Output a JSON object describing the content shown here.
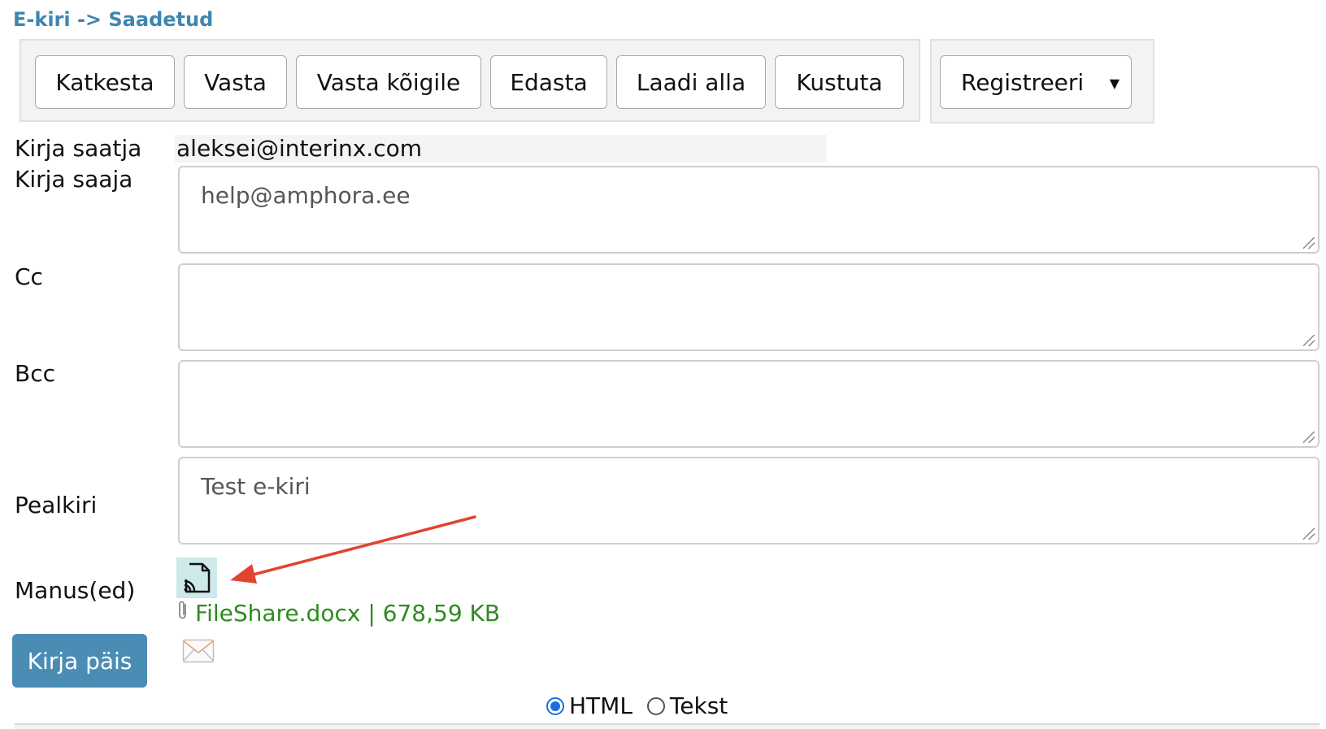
{
  "breadcrumb": "E-kiri -> Saadetud",
  "toolbar": {
    "cancel_label": "Katkesta",
    "reply_label": "Vasta",
    "reply_all_label": "Vasta kõigile",
    "forward_label": "Edasta",
    "download_label": "Laadi alla",
    "delete_label": "Kustuta",
    "register_label": "Registreeri"
  },
  "form": {
    "sender_label": "Kirja saatja",
    "sender_value": "aleksei@interinx.com",
    "recipient_label": "Kirja saaja",
    "recipient_value": "help@amphora.ee",
    "cc_label": "Cc",
    "cc_value": "",
    "bcc_label": "Bcc",
    "bcc_value": "",
    "subject_label": "Pealkiri",
    "subject_value": "Test e-kiri",
    "attachments_label": "Manus(ed)"
  },
  "attachment": {
    "file_text": "FileShare.docx | 678,59 KB"
  },
  "header_button_label": "Kirja päis",
  "format": {
    "html_label": "HTML",
    "text_label": "Tekst",
    "selected": "HTML"
  },
  "colors": {
    "breadcrumb": "#3d86b0",
    "header_button": "#4a8cb4",
    "attachment_link": "#2e8b1f",
    "annotation_arrow": "#e2442f",
    "attach_tile": "#cde9ea"
  },
  "icons": {
    "attachment_tile": "file-share-icon",
    "paperclip": "paperclip-icon",
    "envelope": "envelope-icon",
    "dropdown": "dropdown-arrow-icon"
  }
}
